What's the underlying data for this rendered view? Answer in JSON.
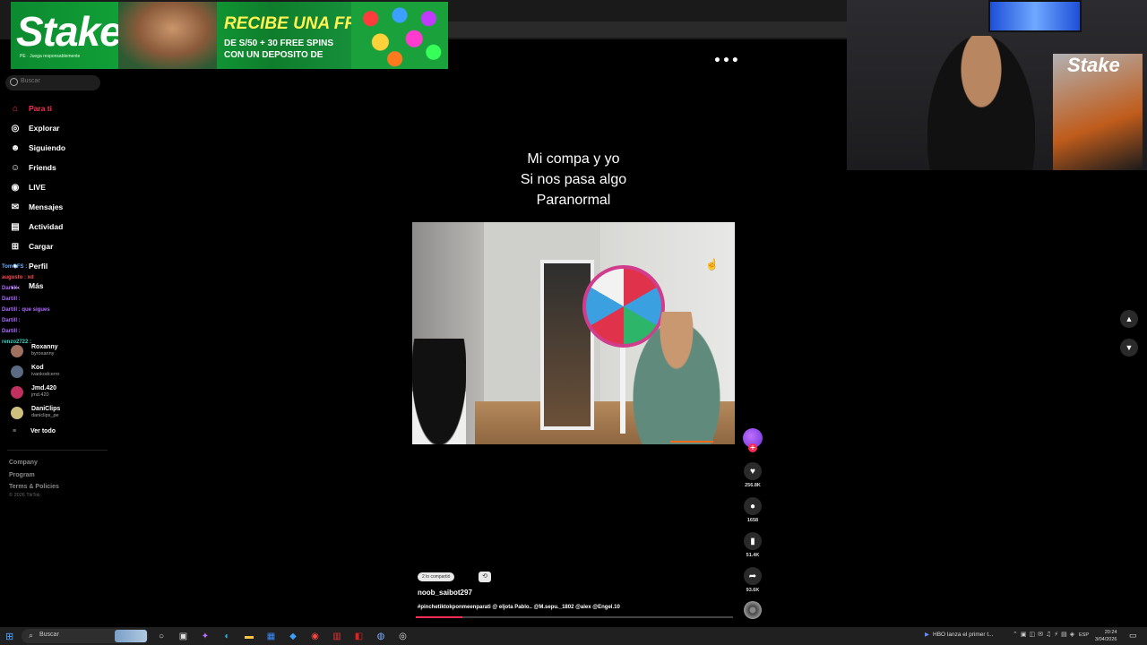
{
  "ad": {
    "brand": "Stake",
    "brand_sub": "PE · Juega responsablemente",
    "headline": "RECIBE UNA FREEBET",
    "line1": "DE S/50 + 30 FREE SPINS",
    "line2": "CON UN DEPOSITO DE"
  },
  "webcam": {
    "logo": "Stake"
  },
  "search": {
    "placeholder": "Buscar"
  },
  "nav": {
    "items": [
      {
        "label": "Para ti",
        "icon": "⌂"
      },
      {
        "label": "Explorar",
        "icon": "◎"
      },
      {
        "label": "Siguiendo",
        "icon": "☻"
      },
      {
        "label": "Friends",
        "icon": "☺"
      },
      {
        "label": "LIVE",
        "icon": "◉"
      },
      {
        "label": "Mensajes",
        "icon": "✉"
      },
      {
        "label": "Actividad",
        "icon": "▤"
      },
      {
        "label": "Cargar",
        "icon": "⊞"
      },
      {
        "label": "Perfil",
        "icon": "●"
      },
      {
        "label": "Más",
        "icon": "…"
      }
    ]
  },
  "following": [
    {
      "name": "Roxanny",
      "user": "byroxanny"
    },
    {
      "name": "Kod",
      "user": "ivankodcerro"
    },
    {
      "name": "Jmd.420",
      "user": "jmd.420"
    },
    {
      "name": "DaniClips",
      "user": "daniclips_pe"
    }
  ],
  "see_all": "Ver todo",
  "footer": {
    "links": [
      "Company",
      "Program",
      "Terms & Policies"
    ],
    "copyright": "© 2026 TikTok"
  },
  "chat": [
    {
      "text": "TomOFS : ",
      "color": "#6fb3ff"
    },
    {
      "text": "augusto : xd",
      "color": "#ff4d4d"
    },
    {
      "text": "Dartill : ",
      "color": "#b06bff"
    },
    {
      "text": "Dartill : ",
      "color": "#b06bff"
    },
    {
      "text": "Dartill : que sigues",
      "color": "#b06bff"
    },
    {
      "text": "Dartill : ",
      "color": "#b06bff"
    },
    {
      "text": "Dartill : ",
      "color": "#b06bff"
    },
    {
      "text": "renzo2722 : ",
      "color": "#3dd6c4"
    }
  ],
  "caption": {
    "line1": "Mi compa y yo",
    "line2": "Si nos pasa algo",
    "line3": "Paranormal"
  },
  "actions": {
    "likes": "256.8K",
    "comments": "1658",
    "saves": "51.4K",
    "shares": "93.6K"
  },
  "post": {
    "shared": "2 lo compartió",
    "author": "noob_saibot297",
    "description": "#pinchetiktokponmeenparati @ eljota Pablo.. @M.sepu._1802 @alex @Engel.10"
  },
  "taskbar": {
    "search_placeholder": "Buscar",
    "news": "HBO lanza el primer t...",
    "lang": "ESP",
    "time": "20:24",
    "date": "3/04/2026"
  },
  "colors": {
    "accent": "#fe2c55",
    "background": "#000000"
  }
}
